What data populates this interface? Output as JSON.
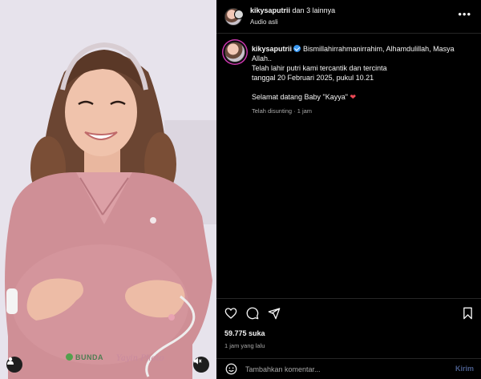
{
  "post": {
    "header": {
      "username": "kikysaputrii",
      "collab_text": "dan 3 lainnya",
      "audio": "Audio asli",
      "more_icon": "more-horizontal-icon"
    },
    "caption": {
      "username": "kikysaputrii",
      "line1": "Bismillahirrahmanirrahim, Alhamdulillah, Masya Allah..",
      "line2": "Telah lahir putri kami tercantik dan tercinta",
      "line3": "tanggal 20 Februari 2025, pukul 10.21",
      "line4": "Selamat datang Baby \"Kayya\"",
      "heart": "❤",
      "edited": "Telah disunting · 1 jam"
    },
    "media": {
      "watermark_left": "BUNDA",
      "watermark_right": "Yayin Photo"
    },
    "stats": {
      "likes": "59.775 suka",
      "time": "1 jam yang lalu"
    },
    "comment": {
      "placeholder": "Tambahkan komentar...",
      "send": "Kirim"
    }
  },
  "colors": {
    "background": "#000000",
    "verified": "#3897f0",
    "heart": "#ed4956",
    "send_disabled": "#4a5d8c"
  }
}
